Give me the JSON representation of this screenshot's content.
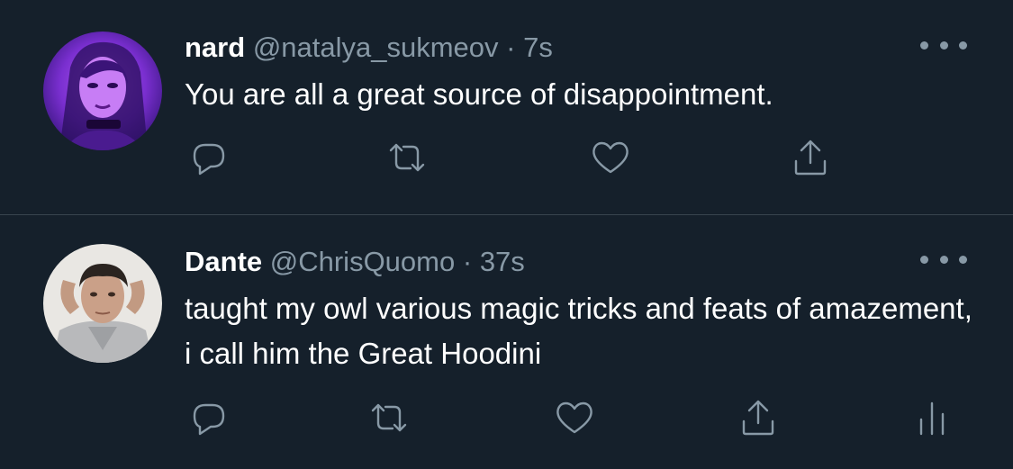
{
  "theme": {
    "background": "#15202b",
    "divider": "#38444d",
    "primary_text": "#ffffff",
    "secondary_text": "#8899a6"
  },
  "tweets": [
    {
      "display_name": "nard",
      "handle": "@natalya_sukmeov",
      "separator": "·",
      "time": "7s",
      "text": "You are all a great source of disappointment.",
      "avatar": "purple-anime-avatar",
      "actions": [
        "reply-icon",
        "retweet-icon",
        "like-icon",
        "share-icon"
      ]
    },
    {
      "display_name": "Dante",
      "handle": "@ChrisQuomo",
      "separator": "·",
      "time": "37s",
      "text": "taught my owl various magic tricks and feats of amazement, i call him the Great Hoodini",
      "avatar": "man-photo-avatar",
      "actions": [
        "reply-icon",
        "retweet-icon",
        "like-icon",
        "share-icon",
        "analytics-icon"
      ]
    }
  ]
}
